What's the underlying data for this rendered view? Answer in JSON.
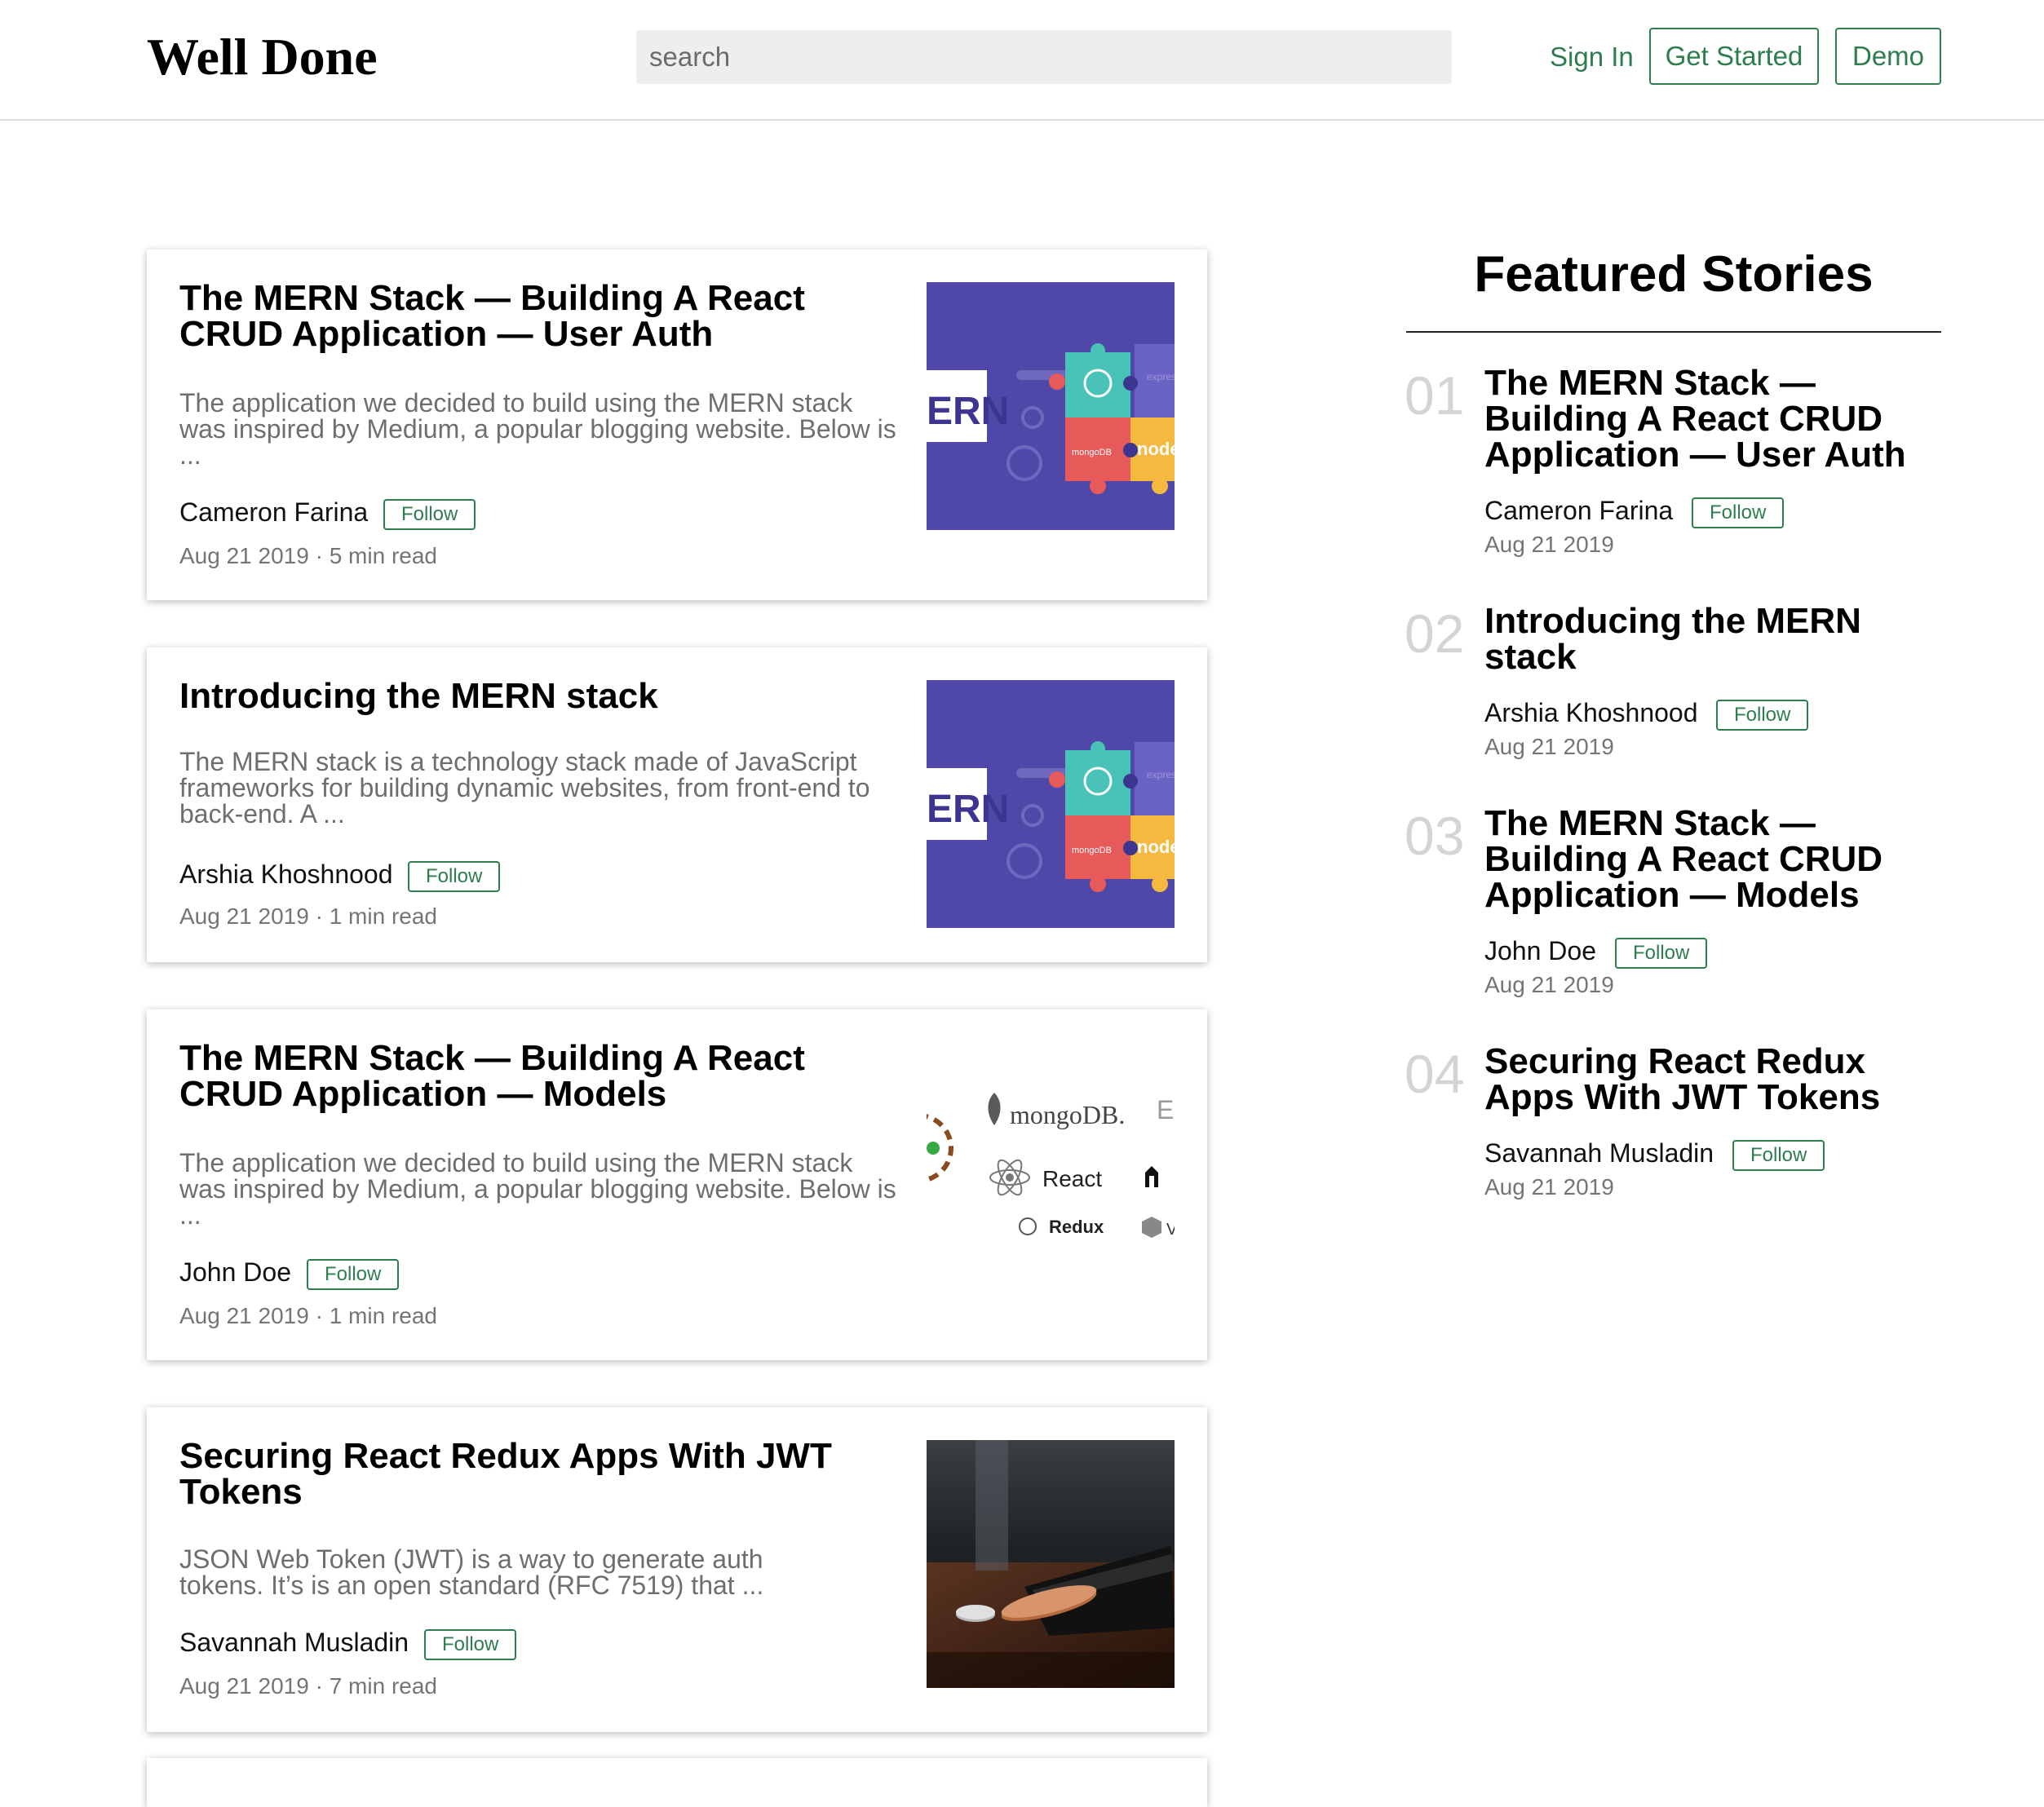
{
  "header": {
    "brand": "Well Done",
    "search_placeholder": "search",
    "sign_in": "Sign In",
    "get_started": "Get Started",
    "demo": "Demo"
  },
  "articles": [
    {
      "title": "The MERN Stack — Building A React CRUD Application — User Auth",
      "excerpt": "The application we decided to build using the MERN stack was inspired by Medium, a popular blogging website. Below is ...",
      "author": "Cameron Farina",
      "follow": "Follow",
      "meta": "Aug 21 2019 · 5 min read",
      "image": "mern-puzzle-illustration"
    },
    {
      "title": "Introducing the MERN stack",
      "excerpt": "The MERN stack is a technology stack made of JavaScript frameworks for building dynamic websites, from front-end to back-end. A ...",
      "author": "Arshia Khoshnood",
      "follow": "Follow",
      "meta": "Aug 21 2019 · 1 min read",
      "image": "mern-puzzle-illustration"
    },
    {
      "title": "The MERN Stack — Building A React CRUD Application — Models",
      "excerpt": "The application we decided to build using the MERN stack was inspired by Medium, a popular blogging website. Below is ...",
      "author": "John Doe",
      "follow": "Follow",
      "meta": "Aug 21 2019 · 1 min read",
      "image": "tech-logos-image",
      "image_labels": {
        "mongo": "mongoDB.",
        "react": "React",
        "redux": "Redux"
      }
    },
    {
      "title": "Securing React Redux Apps With JWT Tokens",
      "excerpt": "JSON Web Token (JWT) is a way to generate auth tokens. It’s is an open standard (RFC 7519) that ...",
      "author": "Savannah Musladin",
      "follow": "Follow",
      "meta": "Aug 21 2019 · 7 min read",
      "image": "wallet-coins-photo"
    }
  ],
  "sidebar": {
    "heading": "Featured Stories",
    "items": [
      {
        "num": "01",
        "title": "The MERN Stack — Building A React CRUD Application — User Auth",
        "author": "Cameron Farina",
        "follow": "Follow",
        "date": "Aug 21 2019"
      },
      {
        "num": "02",
        "title": "Introducing the MERN stack",
        "author": "Arshia Khoshnood",
        "follow": "Follow",
        "date": "Aug 21 2019"
      },
      {
        "num": "03",
        "title": "The MERN Stack — Building A React CRUD Application — Models",
        "author": "John Doe",
        "follow": "Follow",
        "date": "Aug 21 2019"
      },
      {
        "num": "04",
        "title": "Securing React Redux Apps With JWT Tokens",
        "author": "Savannah Musladin",
        "follow": "Follow",
        "date": "Aug 21 2019"
      }
    ]
  },
  "colors": {
    "accent": "#2e7d4f",
    "meta_text": "#757575",
    "excerpt_text": "#6e6e6e",
    "number_grey": "#d4d4d4"
  }
}
